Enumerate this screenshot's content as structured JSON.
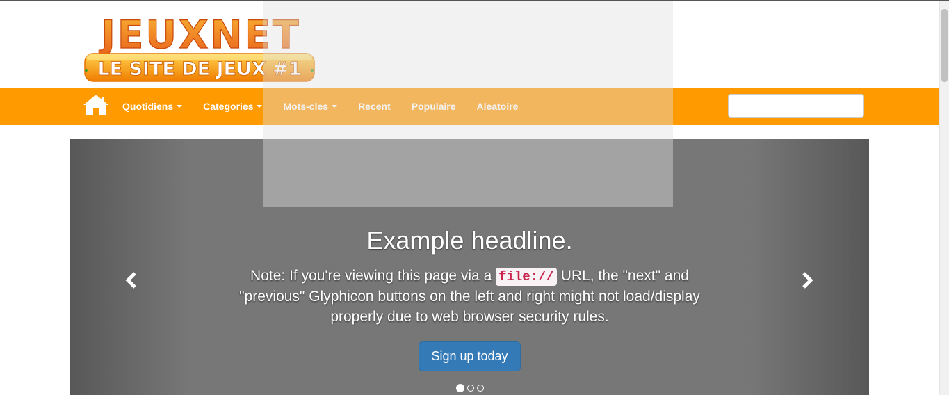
{
  "logo": {
    "title": "JEUXNET",
    "tagline": "LE SITE DE JEUX #1",
    "colors": {
      "orange": "#f7931e",
      "banner": "#f59b00",
      "text_dark": "#e0580c"
    }
  },
  "navbar": {
    "background": "#ff9a00",
    "home_icon": "home-icon",
    "items": [
      {
        "label": "Quotidiens",
        "dropdown": true
      },
      {
        "label": "Categories",
        "dropdown": true
      },
      {
        "label": "Mots-cles",
        "dropdown": true
      },
      {
        "label": "Recent",
        "dropdown": false
      },
      {
        "label": "Populaire",
        "dropdown": false
      },
      {
        "label": "Aleatoire",
        "dropdown": false
      }
    ],
    "search": {
      "value": "",
      "placeholder": ""
    }
  },
  "carousel": {
    "headline": "Example headline.",
    "caption_before": "Note: If you're viewing this page via a ",
    "caption_code": "file://",
    "caption_after": " URL, the \"next\" and \"previous\" Glyphicon buttons on the left and right might not load/display properly due to web browser security rules.",
    "button_label": "Sign up today",
    "prev_icon": "chevron-left-icon",
    "next_icon": "chevron-right-icon",
    "slide_count": 3,
    "active_slide": 1,
    "colors": {
      "button": "#337ab7",
      "code_text": "#c7254e",
      "code_bg": "#f9f2f4"
    }
  }
}
